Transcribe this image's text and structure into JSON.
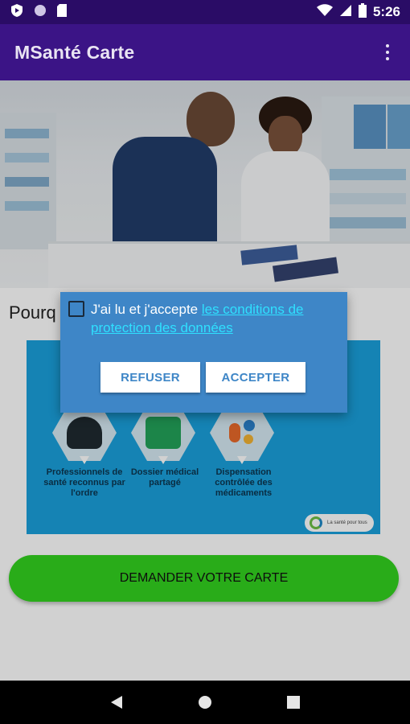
{
  "status_bar": {
    "time": "5:26",
    "icons": [
      "play-protect-icon",
      "circle-icon",
      "sd-card-icon",
      "wifi-icon",
      "signal-icon",
      "battery-icon"
    ]
  },
  "app_bar": {
    "title": "MSanté Carte",
    "menu_icon": "more-vert-icon"
  },
  "content": {
    "intro_text": "Pourq",
    "panel": {
      "items": [
        {
          "label": "Professionnels de santé reconnus par l'ordre",
          "icon": "doctor-icon"
        },
        {
          "label": "Dossier médical partagé",
          "icon": "medical-folder-icon"
        },
        {
          "label": "Dispensation contrôlée des médicaments",
          "icon": "pills-icon"
        }
      ],
      "badge_text": "La santé pour tous"
    },
    "cta_label": "DEMANDER VOTRE CARTE"
  },
  "dialog": {
    "consent_text": "J'ai lu et j'accepte ",
    "consent_link": "les conditions de protection des données",
    "refuse_label": "REFUSER",
    "accept_label": "ACCEPTER"
  },
  "nav_bar": {
    "buttons": [
      "back-icon",
      "home-icon",
      "recents-icon"
    ]
  },
  "colors": {
    "status_bar": "#2a0c66",
    "app_bar": "#3b1486",
    "dialog": "#3e86c7",
    "link": "#2fe0ff",
    "cta": "#33d21f",
    "panel": "#1aa0dc"
  }
}
